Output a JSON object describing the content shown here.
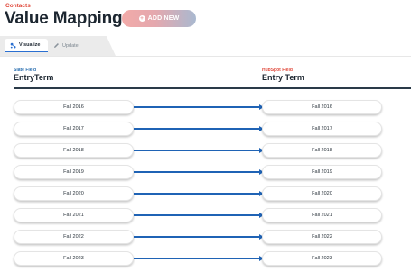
{
  "breadcrumb": "Contacts",
  "page_title": "Value Mapping",
  "add_button_label": "ADD NEW",
  "tabs": [
    {
      "label": "Visualize",
      "icon": "network-icon",
      "active": true
    },
    {
      "label": "Update",
      "icon": "pencil-icon",
      "active": false
    }
  ],
  "source": {
    "label": "Slate Field",
    "name": "EntryTerm"
  },
  "target": {
    "label": "HubSpot Field",
    "name": "Entry Term"
  },
  "mappings": [
    {
      "from": "Fall 2016",
      "to": "Fall 2016"
    },
    {
      "from": "Fall 2017",
      "to": "Fall 2017"
    },
    {
      "from": "Fall 2018",
      "to": "Fall 2018"
    },
    {
      "from": "Fall 2019",
      "to": "Fall 2019"
    },
    {
      "from": "Fall 2020",
      "to": "Fall 2020"
    },
    {
      "from": "Fall 2021",
      "to": "Fall 2021"
    },
    {
      "from": "Fall 2022",
      "to": "Fall 2022"
    },
    {
      "from": "Fall 2023",
      "to": "Fall 2023"
    }
  ],
  "colors": {
    "accent_red": "#e0483a",
    "accent_blue": "#2a6fb0",
    "arrow": "#1f63b5"
  }
}
